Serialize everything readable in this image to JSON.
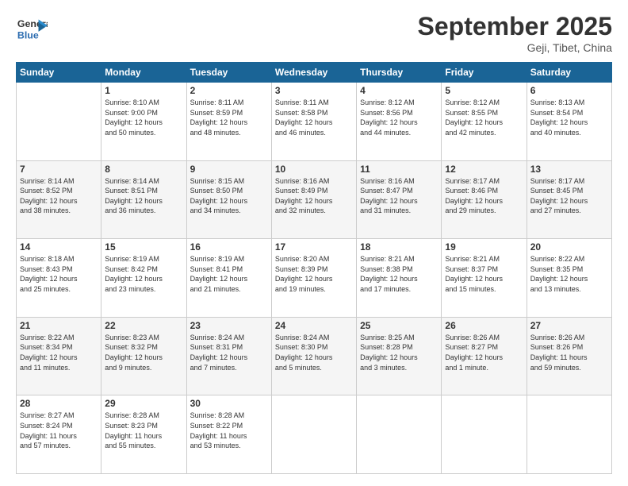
{
  "header": {
    "logo_line1": "General",
    "logo_line2": "Blue",
    "month_title": "September 2025",
    "location": "Geji, Tibet, China"
  },
  "weekdays": [
    "Sunday",
    "Monday",
    "Tuesday",
    "Wednesday",
    "Thursday",
    "Friday",
    "Saturday"
  ],
  "weeks": [
    [
      {
        "day": "",
        "info": ""
      },
      {
        "day": "1",
        "info": "Sunrise: 8:10 AM\nSunset: 9:00 PM\nDaylight: 12 hours\nand 50 minutes."
      },
      {
        "day": "2",
        "info": "Sunrise: 8:11 AM\nSunset: 8:59 PM\nDaylight: 12 hours\nand 48 minutes."
      },
      {
        "day": "3",
        "info": "Sunrise: 8:11 AM\nSunset: 8:58 PM\nDaylight: 12 hours\nand 46 minutes."
      },
      {
        "day": "4",
        "info": "Sunrise: 8:12 AM\nSunset: 8:56 PM\nDaylight: 12 hours\nand 44 minutes."
      },
      {
        "day": "5",
        "info": "Sunrise: 8:12 AM\nSunset: 8:55 PM\nDaylight: 12 hours\nand 42 minutes."
      },
      {
        "day": "6",
        "info": "Sunrise: 8:13 AM\nSunset: 8:54 PM\nDaylight: 12 hours\nand 40 minutes."
      }
    ],
    [
      {
        "day": "7",
        "info": "Sunrise: 8:14 AM\nSunset: 8:52 PM\nDaylight: 12 hours\nand 38 minutes."
      },
      {
        "day": "8",
        "info": "Sunrise: 8:14 AM\nSunset: 8:51 PM\nDaylight: 12 hours\nand 36 minutes."
      },
      {
        "day": "9",
        "info": "Sunrise: 8:15 AM\nSunset: 8:50 PM\nDaylight: 12 hours\nand 34 minutes."
      },
      {
        "day": "10",
        "info": "Sunrise: 8:16 AM\nSunset: 8:49 PM\nDaylight: 12 hours\nand 32 minutes."
      },
      {
        "day": "11",
        "info": "Sunrise: 8:16 AM\nSunset: 8:47 PM\nDaylight: 12 hours\nand 31 minutes."
      },
      {
        "day": "12",
        "info": "Sunrise: 8:17 AM\nSunset: 8:46 PM\nDaylight: 12 hours\nand 29 minutes."
      },
      {
        "day": "13",
        "info": "Sunrise: 8:17 AM\nSunset: 8:45 PM\nDaylight: 12 hours\nand 27 minutes."
      }
    ],
    [
      {
        "day": "14",
        "info": "Sunrise: 8:18 AM\nSunset: 8:43 PM\nDaylight: 12 hours\nand 25 minutes."
      },
      {
        "day": "15",
        "info": "Sunrise: 8:19 AM\nSunset: 8:42 PM\nDaylight: 12 hours\nand 23 minutes."
      },
      {
        "day": "16",
        "info": "Sunrise: 8:19 AM\nSunset: 8:41 PM\nDaylight: 12 hours\nand 21 minutes."
      },
      {
        "day": "17",
        "info": "Sunrise: 8:20 AM\nSunset: 8:39 PM\nDaylight: 12 hours\nand 19 minutes."
      },
      {
        "day": "18",
        "info": "Sunrise: 8:21 AM\nSunset: 8:38 PM\nDaylight: 12 hours\nand 17 minutes."
      },
      {
        "day": "19",
        "info": "Sunrise: 8:21 AM\nSunset: 8:37 PM\nDaylight: 12 hours\nand 15 minutes."
      },
      {
        "day": "20",
        "info": "Sunrise: 8:22 AM\nSunset: 8:35 PM\nDaylight: 12 hours\nand 13 minutes."
      }
    ],
    [
      {
        "day": "21",
        "info": "Sunrise: 8:22 AM\nSunset: 8:34 PM\nDaylight: 12 hours\nand 11 minutes."
      },
      {
        "day": "22",
        "info": "Sunrise: 8:23 AM\nSunset: 8:32 PM\nDaylight: 12 hours\nand 9 minutes."
      },
      {
        "day": "23",
        "info": "Sunrise: 8:24 AM\nSunset: 8:31 PM\nDaylight: 12 hours\nand 7 minutes."
      },
      {
        "day": "24",
        "info": "Sunrise: 8:24 AM\nSunset: 8:30 PM\nDaylight: 12 hours\nand 5 minutes."
      },
      {
        "day": "25",
        "info": "Sunrise: 8:25 AM\nSunset: 8:28 PM\nDaylight: 12 hours\nand 3 minutes."
      },
      {
        "day": "26",
        "info": "Sunrise: 8:26 AM\nSunset: 8:27 PM\nDaylight: 12 hours\nand 1 minute."
      },
      {
        "day": "27",
        "info": "Sunrise: 8:26 AM\nSunset: 8:26 PM\nDaylight: 11 hours\nand 59 minutes."
      }
    ],
    [
      {
        "day": "28",
        "info": "Sunrise: 8:27 AM\nSunset: 8:24 PM\nDaylight: 11 hours\nand 57 minutes."
      },
      {
        "day": "29",
        "info": "Sunrise: 8:28 AM\nSunset: 8:23 PM\nDaylight: 11 hours\nand 55 minutes."
      },
      {
        "day": "30",
        "info": "Sunrise: 8:28 AM\nSunset: 8:22 PM\nDaylight: 11 hours\nand 53 minutes."
      },
      {
        "day": "",
        "info": ""
      },
      {
        "day": "",
        "info": ""
      },
      {
        "day": "",
        "info": ""
      },
      {
        "day": "",
        "info": ""
      }
    ]
  ]
}
